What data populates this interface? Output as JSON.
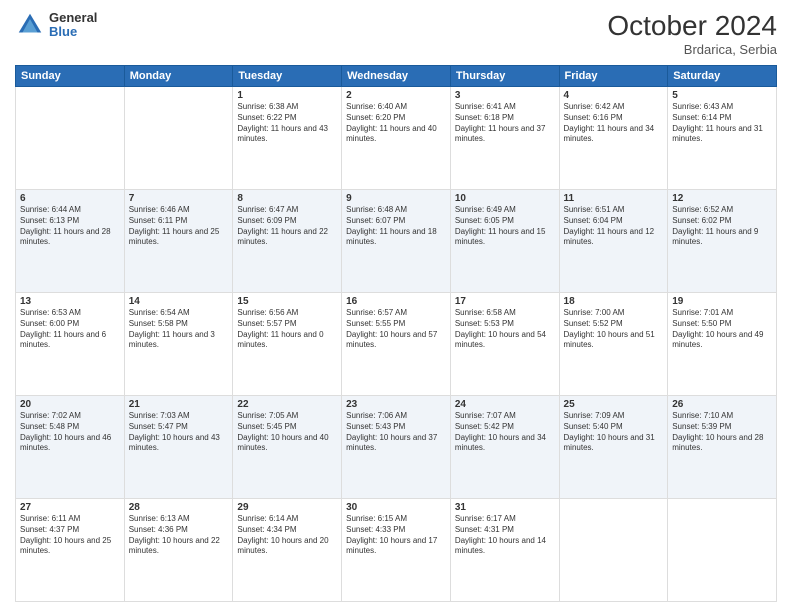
{
  "header": {
    "logo_line1": "General",
    "logo_line2": "Blue",
    "month": "October 2024",
    "location": "Brdarica, Serbia"
  },
  "weekdays": [
    "Sunday",
    "Monday",
    "Tuesday",
    "Wednesday",
    "Thursday",
    "Friday",
    "Saturday"
  ],
  "weeks": [
    [
      {
        "day": "",
        "sunrise": "",
        "sunset": "",
        "daylight": ""
      },
      {
        "day": "",
        "sunrise": "",
        "sunset": "",
        "daylight": ""
      },
      {
        "day": "1",
        "sunrise": "Sunrise: 6:38 AM",
        "sunset": "Sunset: 6:22 PM",
        "daylight": "Daylight: 11 hours and 43 minutes."
      },
      {
        "day": "2",
        "sunrise": "Sunrise: 6:40 AM",
        "sunset": "Sunset: 6:20 PM",
        "daylight": "Daylight: 11 hours and 40 minutes."
      },
      {
        "day": "3",
        "sunrise": "Sunrise: 6:41 AM",
        "sunset": "Sunset: 6:18 PM",
        "daylight": "Daylight: 11 hours and 37 minutes."
      },
      {
        "day": "4",
        "sunrise": "Sunrise: 6:42 AM",
        "sunset": "Sunset: 6:16 PM",
        "daylight": "Daylight: 11 hours and 34 minutes."
      },
      {
        "day": "5",
        "sunrise": "Sunrise: 6:43 AM",
        "sunset": "Sunset: 6:14 PM",
        "daylight": "Daylight: 11 hours and 31 minutes."
      }
    ],
    [
      {
        "day": "6",
        "sunrise": "Sunrise: 6:44 AM",
        "sunset": "Sunset: 6:13 PM",
        "daylight": "Daylight: 11 hours and 28 minutes."
      },
      {
        "day": "7",
        "sunrise": "Sunrise: 6:46 AM",
        "sunset": "Sunset: 6:11 PM",
        "daylight": "Daylight: 11 hours and 25 minutes."
      },
      {
        "day": "8",
        "sunrise": "Sunrise: 6:47 AM",
        "sunset": "Sunset: 6:09 PM",
        "daylight": "Daylight: 11 hours and 22 minutes."
      },
      {
        "day": "9",
        "sunrise": "Sunrise: 6:48 AM",
        "sunset": "Sunset: 6:07 PM",
        "daylight": "Daylight: 11 hours and 18 minutes."
      },
      {
        "day": "10",
        "sunrise": "Sunrise: 6:49 AM",
        "sunset": "Sunset: 6:05 PM",
        "daylight": "Daylight: 11 hours and 15 minutes."
      },
      {
        "day": "11",
        "sunrise": "Sunrise: 6:51 AM",
        "sunset": "Sunset: 6:04 PM",
        "daylight": "Daylight: 11 hours and 12 minutes."
      },
      {
        "day": "12",
        "sunrise": "Sunrise: 6:52 AM",
        "sunset": "Sunset: 6:02 PM",
        "daylight": "Daylight: 11 hours and 9 minutes."
      }
    ],
    [
      {
        "day": "13",
        "sunrise": "Sunrise: 6:53 AM",
        "sunset": "Sunset: 6:00 PM",
        "daylight": "Daylight: 11 hours and 6 minutes."
      },
      {
        "day": "14",
        "sunrise": "Sunrise: 6:54 AM",
        "sunset": "Sunset: 5:58 PM",
        "daylight": "Daylight: 11 hours and 3 minutes."
      },
      {
        "day": "15",
        "sunrise": "Sunrise: 6:56 AM",
        "sunset": "Sunset: 5:57 PM",
        "daylight": "Daylight: 11 hours and 0 minutes."
      },
      {
        "day": "16",
        "sunrise": "Sunrise: 6:57 AM",
        "sunset": "Sunset: 5:55 PM",
        "daylight": "Daylight: 10 hours and 57 minutes."
      },
      {
        "day": "17",
        "sunrise": "Sunrise: 6:58 AM",
        "sunset": "Sunset: 5:53 PM",
        "daylight": "Daylight: 10 hours and 54 minutes."
      },
      {
        "day": "18",
        "sunrise": "Sunrise: 7:00 AM",
        "sunset": "Sunset: 5:52 PM",
        "daylight": "Daylight: 10 hours and 51 minutes."
      },
      {
        "day": "19",
        "sunrise": "Sunrise: 7:01 AM",
        "sunset": "Sunset: 5:50 PM",
        "daylight": "Daylight: 10 hours and 49 minutes."
      }
    ],
    [
      {
        "day": "20",
        "sunrise": "Sunrise: 7:02 AM",
        "sunset": "Sunset: 5:48 PM",
        "daylight": "Daylight: 10 hours and 46 minutes."
      },
      {
        "day": "21",
        "sunrise": "Sunrise: 7:03 AM",
        "sunset": "Sunset: 5:47 PM",
        "daylight": "Daylight: 10 hours and 43 minutes."
      },
      {
        "day": "22",
        "sunrise": "Sunrise: 7:05 AM",
        "sunset": "Sunset: 5:45 PM",
        "daylight": "Daylight: 10 hours and 40 minutes."
      },
      {
        "day": "23",
        "sunrise": "Sunrise: 7:06 AM",
        "sunset": "Sunset: 5:43 PM",
        "daylight": "Daylight: 10 hours and 37 minutes."
      },
      {
        "day": "24",
        "sunrise": "Sunrise: 7:07 AM",
        "sunset": "Sunset: 5:42 PM",
        "daylight": "Daylight: 10 hours and 34 minutes."
      },
      {
        "day": "25",
        "sunrise": "Sunrise: 7:09 AM",
        "sunset": "Sunset: 5:40 PM",
        "daylight": "Daylight: 10 hours and 31 minutes."
      },
      {
        "day": "26",
        "sunrise": "Sunrise: 7:10 AM",
        "sunset": "Sunset: 5:39 PM",
        "daylight": "Daylight: 10 hours and 28 minutes."
      }
    ],
    [
      {
        "day": "27",
        "sunrise": "Sunrise: 6:11 AM",
        "sunset": "Sunset: 4:37 PM",
        "daylight": "Daylight: 10 hours and 25 minutes."
      },
      {
        "day": "28",
        "sunrise": "Sunrise: 6:13 AM",
        "sunset": "Sunset: 4:36 PM",
        "daylight": "Daylight: 10 hours and 22 minutes."
      },
      {
        "day": "29",
        "sunrise": "Sunrise: 6:14 AM",
        "sunset": "Sunset: 4:34 PM",
        "daylight": "Daylight: 10 hours and 20 minutes."
      },
      {
        "day": "30",
        "sunrise": "Sunrise: 6:15 AM",
        "sunset": "Sunset: 4:33 PM",
        "daylight": "Daylight: 10 hours and 17 minutes."
      },
      {
        "day": "31",
        "sunrise": "Sunrise: 6:17 AM",
        "sunset": "Sunset: 4:31 PM",
        "daylight": "Daylight: 10 hours and 14 minutes."
      },
      {
        "day": "",
        "sunrise": "",
        "sunset": "",
        "daylight": ""
      },
      {
        "day": "",
        "sunrise": "",
        "sunset": "",
        "daylight": ""
      }
    ]
  ]
}
